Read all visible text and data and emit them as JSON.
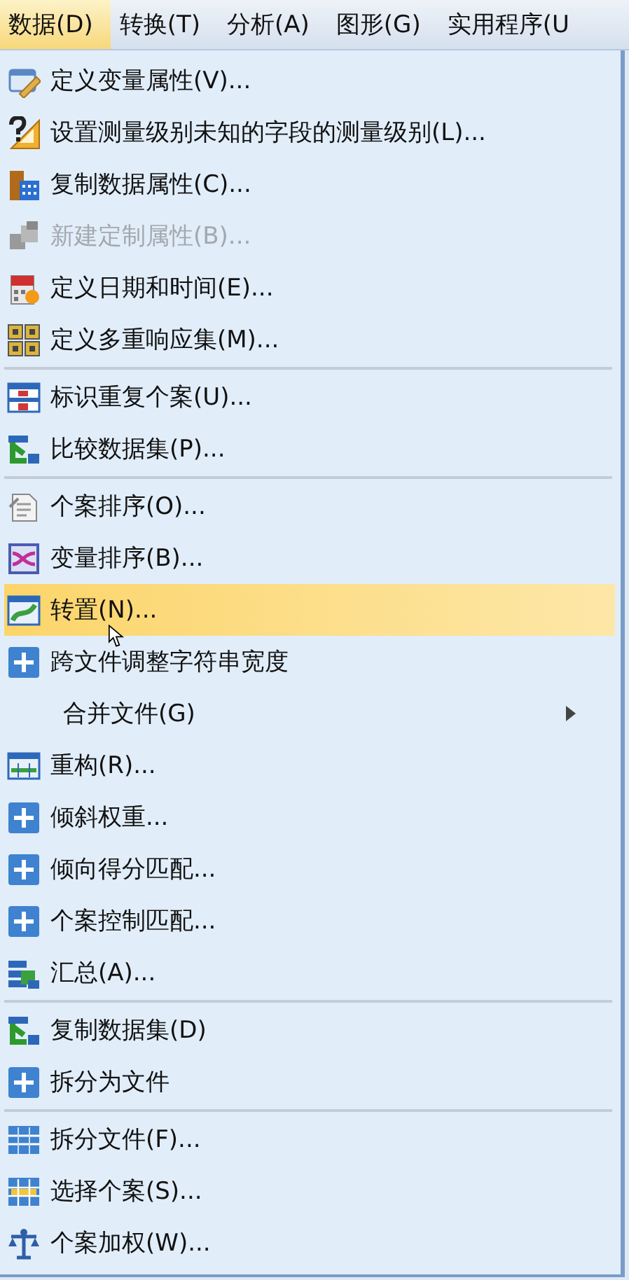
{
  "menubar": [
    {
      "label": "数据(D)",
      "selected": true
    },
    {
      "label": "转换(T)",
      "selected": false
    },
    {
      "label": "分析(A)",
      "selected": false
    },
    {
      "label": "图形(G)",
      "selected": false
    },
    {
      "label": "实用程序(U",
      "selected": false
    }
  ],
  "menu": {
    "items": [
      {
        "kind": "item",
        "label": "定义变量属性(V)...",
        "disabled": false,
        "highlighted": false,
        "submenu": false
      },
      {
        "kind": "item",
        "label": "设置测量级别未知的字段的测量级别(L)...",
        "disabled": false,
        "highlighted": false,
        "submenu": false
      },
      {
        "kind": "item",
        "label": "复制数据属性(C)...",
        "disabled": false,
        "highlighted": false,
        "submenu": false
      },
      {
        "kind": "item",
        "label": "新建定制属性(B)...",
        "disabled": true,
        "highlighted": false,
        "submenu": false
      },
      {
        "kind": "item",
        "label": "定义日期和时间(E)...",
        "disabled": false,
        "highlighted": false,
        "submenu": false
      },
      {
        "kind": "item",
        "label": "定义多重响应集(M)...",
        "disabled": false,
        "highlighted": false,
        "submenu": false
      },
      {
        "kind": "separator"
      },
      {
        "kind": "item",
        "label": "标识重复个案(U)...",
        "disabled": false,
        "highlighted": false,
        "submenu": false
      },
      {
        "kind": "item",
        "label": "比较数据集(P)...",
        "disabled": false,
        "highlighted": false,
        "submenu": false
      },
      {
        "kind": "separator"
      },
      {
        "kind": "item",
        "label": "个案排序(O)...",
        "disabled": false,
        "highlighted": false,
        "submenu": false
      },
      {
        "kind": "item",
        "label": "变量排序(B)...",
        "disabled": false,
        "highlighted": false,
        "submenu": false
      },
      {
        "kind": "item",
        "label": "转置(N)...",
        "disabled": false,
        "highlighted": true,
        "submenu": false
      },
      {
        "kind": "item",
        "label": "跨文件调整字符串宽度",
        "disabled": false,
        "highlighted": false,
        "submenu": false
      },
      {
        "kind": "item",
        "label": "合并文件(G)",
        "disabled": false,
        "highlighted": false,
        "submenu": true
      },
      {
        "kind": "item",
        "label": "重构(R)...",
        "disabled": false,
        "highlighted": false,
        "submenu": false
      },
      {
        "kind": "item",
        "label": "倾斜权重...",
        "disabled": false,
        "highlighted": false,
        "submenu": false
      },
      {
        "kind": "item",
        "label": "倾向得分匹配...",
        "disabled": false,
        "highlighted": false,
        "submenu": false
      },
      {
        "kind": "item",
        "label": "个案控制匹配...",
        "disabled": false,
        "highlighted": false,
        "submenu": false
      },
      {
        "kind": "item",
        "label": "汇总(A)...",
        "disabled": false,
        "highlighted": false,
        "submenu": false
      },
      {
        "kind": "separator"
      },
      {
        "kind": "item",
        "label": "复制数据集(D)",
        "disabled": false,
        "highlighted": false,
        "submenu": false
      },
      {
        "kind": "item",
        "label": "拆分为文件",
        "disabled": false,
        "highlighted": false,
        "submenu": false
      },
      {
        "kind": "separator"
      },
      {
        "kind": "item",
        "label": "拆分文件(F)...",
        "disabled": false,
        "highlighted": false,
        "submenu": false
      },
      {
        "kind": "item",
        "label": "选择个案(S)...",
        "disabled": false,
        "highlighted": false,
        "submenu": false
      },
      {
        "kind": "item",
        "label": "个案加权(W)...",
        "disabled": false,
        "highlighted": false,
        "submenu": false
      }
    ]
  }
}
